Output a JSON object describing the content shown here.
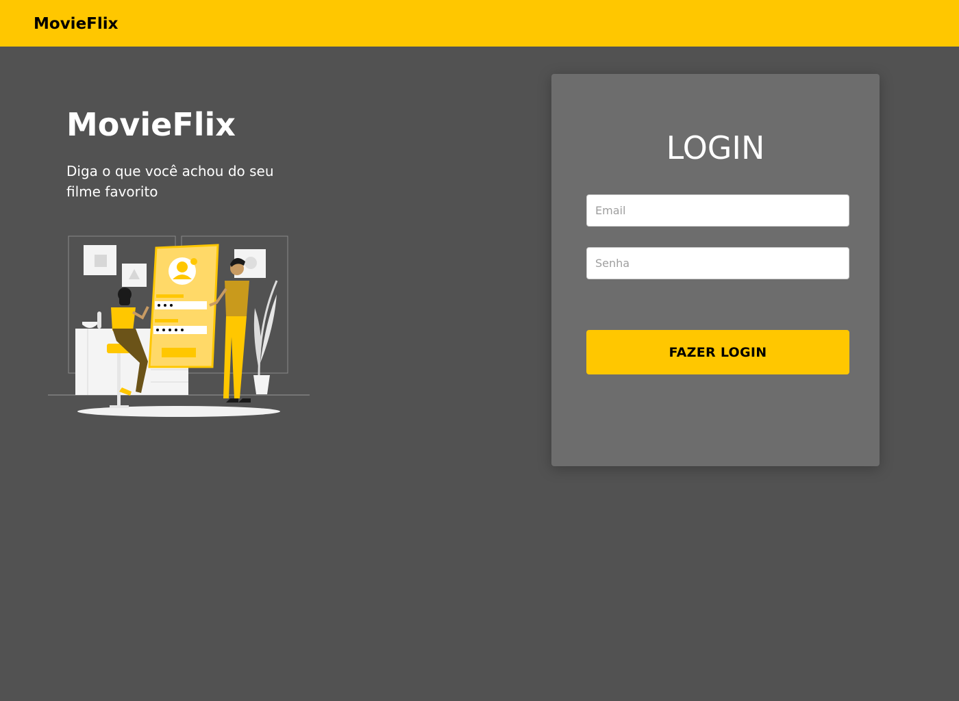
{
  "navbar": {
    "brand": "MovieFlix"
  },
  "hero": {
    "title": "MovieFlix",
    "subtitle": "Diga o que você achou do seu filme favorito"
  },
  "login": {
    "title": "LOGIN",
    "email": {
      "value": "",
      "placeholder": "Email"
    },
    "password": {
      "value": "",
      "placeholder": "Senha"
    },
    "submit_label": "FAZER LOGIN"
  },
  "colors": {
    "accent": "#ffc700",
    "background": "#525252",
    "card": "#6d6d6d"
  },
  "icons": [
    "login-illustration"
  ]
}
